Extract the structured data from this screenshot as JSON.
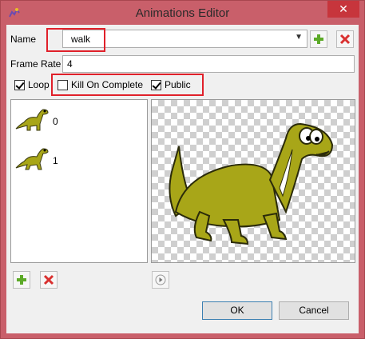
{
  "window": {
    "title": "Animations Editor",
    "close_glyph": "✕"
  },
  "form": {
    "name_label": "Name",
    "name_value": "walk",
    "frame_rate_label": "Frame Rate",
    "frame_rate_value": "4"
  },
  "options": {
    "loop_label": "Loop",
    "loop_checked": true,
    "kill_label": "Kill On Complete",
    "kill_checked": false,
    "public_label": "Public",
    "public_checked": true
  },
  "frames": [
    {
      "label": "0",
      "icon": "dino-frame-icon"
    },
    {
      "label": "1",
      "icon": "dino-frame-icon"
    }
  ],
  "buttons": {
    "ok": "OK",
    "cancel": "Cancel"
  },
  "icons": {
    "add": "plus-icon",
    "delete": "x-icon",
    "play": "play-icon",
    "app": "app-logo-icon",
    "dropdown": "chevron-down-icon"
  },
  "colors": {
    "title_bar": "#c95f6a",
    "dino": "#a8a618",
    "accent_red": "#e0202a",
    "plus_green": "#5caa28",
    "delete_red": "#d9302f"
  }
}
